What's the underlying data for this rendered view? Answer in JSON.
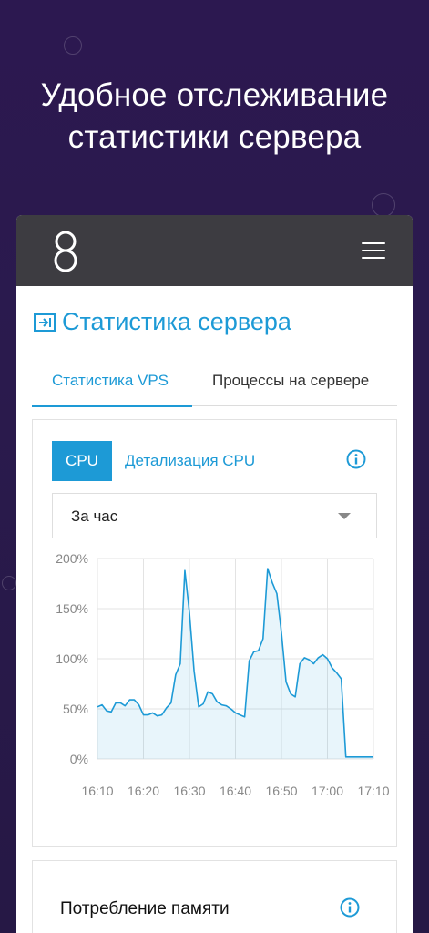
{
  "headline": {
    "line1": "Удобное отслеживание",
    "line2": "статистики сервера"
  },
  "topbar": {
    "logo_icon": "logo-8-icon",
    "menu_icon": "hamburger-menu-icon"
  },
  "page": {
    "title": "Статистика сервера",
    "title_icon": "login-arrow-icon"
  },
  "tabs": [
    {
      "label": "Статистика VPS",
      "active": true
    },
    {
      "label": "Процессы на сервере",
      "active": false
    }
  ],
  "cpu_card": {
    "cpu_button": "CPU",
    "detail_link": "Детализация CPU",
    "info_icon": "info-icon",
    "period_select": {
      "value": "За час",
      "caret_icon": "caret-down-icon"
    }
  },
  "memory_card": {
    "title": "Потребление памяти",
    "info_icon": "info-icon"
  },
  "colors": {
    "accent": "#1d9ad6",
    "topbar": "#3d3c41",
    "background": "#2a1a4d"
  },
  "chart_data": {
    "type": "area",
    "title": "",
    "xlabel": "",
    "ylabel": "",
    "x_ticks": [
      "16:10",
      "16:20",
      "16:30",
      "16:40",
      "16:50",
      "17:00",
      "17:10"
    ],
    "y_ticks": [
      "200%",
      "150%",
      "100%",
      "50%",
      "0%"
    ],
    "ylim": [
      0,
      200
    ],
    "xlim": [
      0,
      60
    ],
    "grid": true,
    "series": [
      {
        "x": [
          0,
          1,
          2,
          3,
          4,
          5,
          6,
          7,
          8,
          9,
          10,
          11,
          12,
          13,
          14,
          15,
          16,
          17,
          18,
          19,
          20,
          21,
          22,
          23,
          24,
          25,
          26,
          27,
          28,
          29,
          30,
          31,
          32,
          33,
          34,
          35,
          36,
          37,
          38,
          39,
          40,
          41,
          42,
          43,
          44,
          45,
          46,
          47,
          48,
          49,
          50,
          51,
          52,
          53,
          54,
          55,
          56,
          57,
          58,
          59,
          60
        ],
        "y": [
          52,
          54,
          48,
          47,
          56,
          56,
          53,
          59,
          59,
          54,
          44,
          44,
          46,
          43,
          44,
          51,
          56,
          84,
          95,
          188,
          146,
          88,
          52,
          55,
          67,
          65,
          57,
          54,
          53,
          50,
          46,
          44,
          42,
          98,
          107,
          108,
          120,
          190,
          176,
          165,
          126,
          77,
          65,
          62,
          95,
          101,
          99,
          95,
          101,
          104,
          100,
          91,
          86,
          80,
          2,
          2,
          2,
          2,
          2,
          2,
          2
        ]
      }
    ]
  }
}
